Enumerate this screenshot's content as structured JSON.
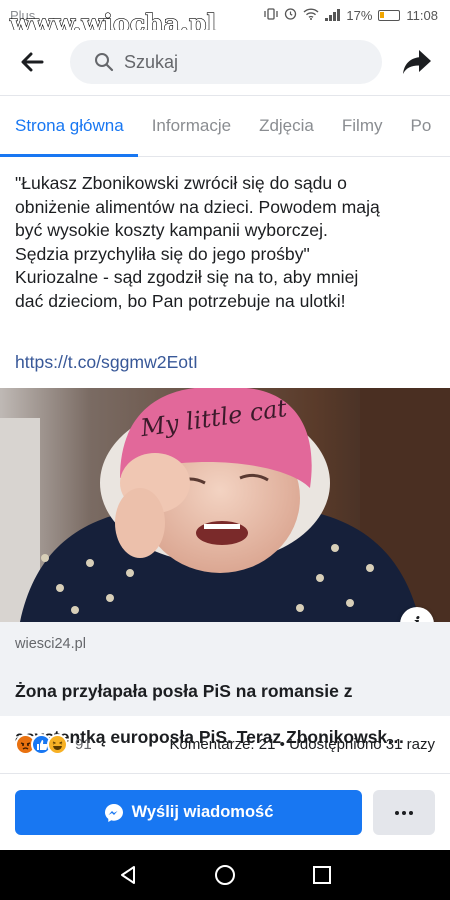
{
  "status_bar": {
    "carrier": "Plus",
    "watermark": "www.wiocha.pl",
    "battery_percent": "17%",
    "time": "11:08"
  },
  "header": {
    "search_placeholder": "Szukaj"
  },
  "tabs": [
    {
      "label": "Strona główna",
      "active": true
    },
    {
      "label": "Informacje",
      "active": false
    },
    {
      "label": "Zdjęcia",
      "active": false
    },
    {
      "label": "Filmy",
      "active": false
    },
    {
      "label": "Po",
      "active": false
    }
  ],
  "post": {
    "text_lines": [
      "\"Łukasz Zbonikowski zwrócił się do sądu o",
      "obniżenie alimentów na dzieci. Powodem mają",
      "być wysokie koszty kampanii wyborczej.",
      "Sędzia przychyliła się do jego prośby\"",
      "Kuriozalne - sąd zgodził się na to, aby mniej",
      "dać dzieciom, bo Pan potrzebuje na ulotki!"
    ],
    "link": "https://t.co/sggmw2EotI",
    "image_hat_text": "My little cat"
  },
  "link_preview": {
    "domain": "wiesci24.pl",
    "title_line1": "Żona przyłapała posła PiS na romansie z",
    "title_line2": "asystentką europosła PiS. Teraz Zbonikowsk…"
  },
  "reactions": {
    "count": "91",
    "comments": "Komentarze: 21",
    "separator": "•",
    "shares": "Udostępniono 31 razy"
  },
  "actions": {
    "message_button": "Wyślij wiadomość"
  },
  "colors": {
    "accent": "#1877f2",
    "link": "#385898",
    "muted": "#65676b",
    "preview_bg": "#f0f2f5"
  }
}
